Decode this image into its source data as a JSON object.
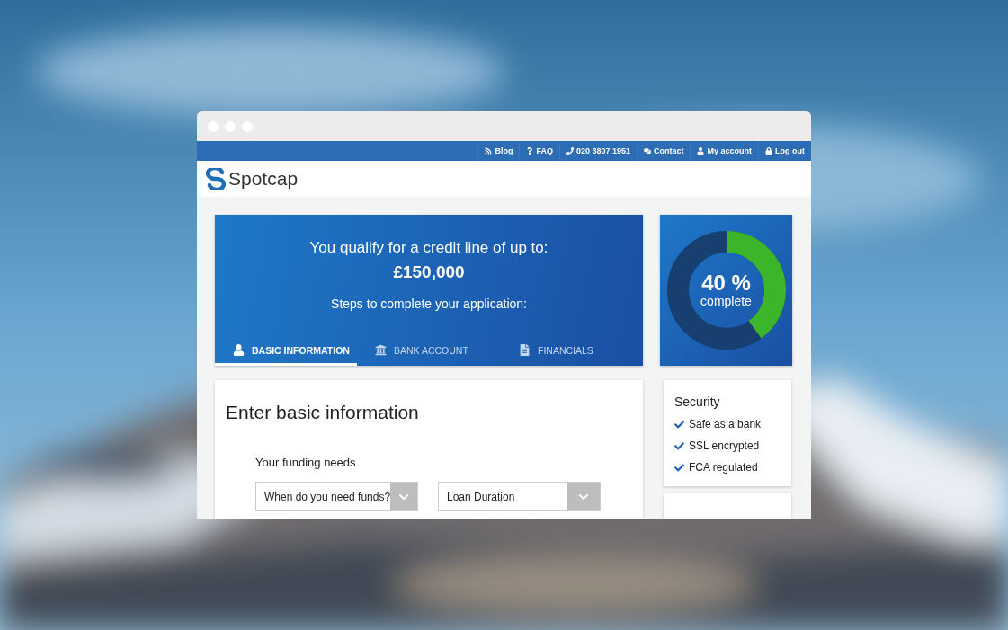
{
  "topbar": {
    "links": [
      {
        "label": "Blog"
      },
      {
        "label": "FAQ"
      },
      {
        "label": "020 3807 1951"
      },
      {
        "label": "Contact"
      },
      {
        "label": "My account"
      },
      {
        "label": "Log out"
      }
    ]
  },
  "logo": {
    "name": "Spotcap"
  },
  "hero": {
    "headline": "You qualify for a credit line of up to:",
    "amount": "£150,000",
    "steps_title": "Steps to complete your application:",
    "steps": [
      {
        "label": "BASIC INFORMATION",
        "selected": true
      },
      {
        "label": "BANK ACCOUNT",
        "selected": false
      },
      {
        "label": "FINANCIALS",
        "selected": false
      }
    ]
  },
  "progress": {
    "level": 0.4,
    "percent": "40 %",
    "label": "complete"
  },
  "form": {
    "title": "Enter basic information",
    "section": "Your funding needs",
    "selects": [
      {
        "placeholder": "When do you need funds?"
      },
      {
        "placeholder": "Loan Duration"
      }
    ]
  },
  "security": {
    "title": "Security",
    "items": [
      "Safe as a bank",
      "SSL encrypted",
      "FCA regulated"
    ]
  }
}
